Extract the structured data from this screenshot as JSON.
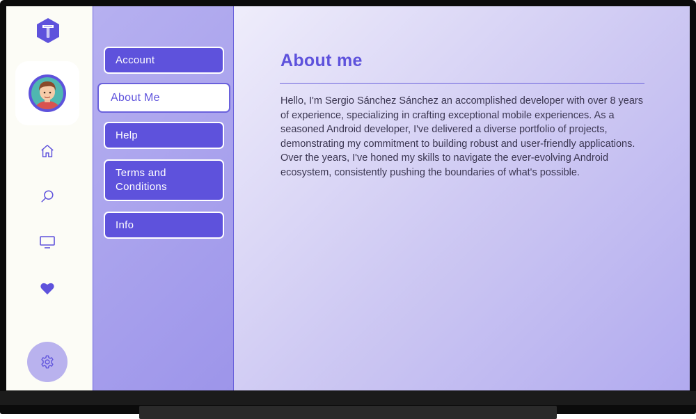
{
  "menu": {
    "items": [
      {
        "label": "Account",
        "selected": false
      },
      {
        "label": "About Me",
        "selected": true
      },
      {
        "label": "Help",
        "selected": false
      },
      {
        "label": "Terms and Conditions",
        "selected": false
      },
      {
        "label": "Info",
        "selected": false
      }
    ]
  },
  "rail": {
    "icons": [
      "home-icon",
      "search-icon",
      "tv-icon",
      "heart-icon",
      "gear-icon"
    ]
  },
  "content": {
    "title": "About me",
    "body": "Hello, I'm Sergio Sánchez Sánchez an accomplished developer with over 8 years of experience, specializing in crafting exceptional mobile experiences. As a seasoned Android developer, I've delivered a diverse portfolio of projects, demonstrating my commitment to building robust and user-friendly applications. Over the years, I've honed my skills to navigate the ever-evolving Android ecosystem, consistently pushing the boundaries of what's possible."
  },
  "colors": {
    "accent": "#5e52dc",
    "rail_background": "#fcfcf6",
    "menu_panel": "#a8a1ee",
    "settings_button": "#b9b2ee"
  }
}
